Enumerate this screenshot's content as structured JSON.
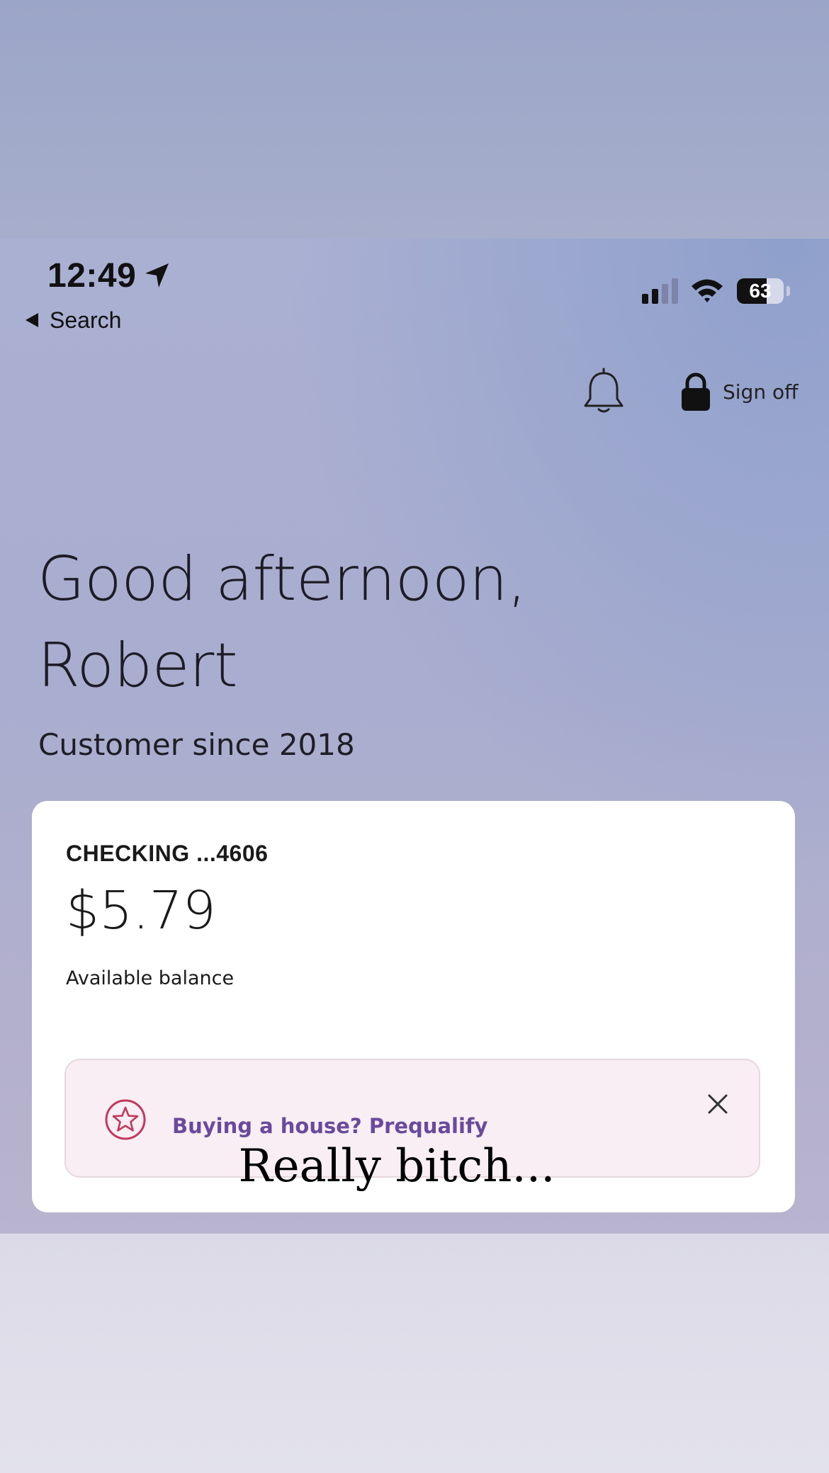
{
  "status_bar": {
    "time": "12:49",
    "battery": "63",
    "battery_level": 0.63,
    "back_label": "Search"
  },
  "header": {
    "sign_off_label": "Sign off"
  },
  "greeting": {
    "line1": "Good afternoon,",
    "line2": "Robert",
    "customer_since": "Customer since 2018"
  },
  "account": {
    "name": "CHECKING ...4606",
    "balance": "$5.79",
    "balance_label": "Available balance"
  },
  "promo": {
    "text": "Buying a house? Prequalify"
  },
  "caption": "Really bitch...",
  "colors": {
    "promo_text": "#6a4a9c",
    "promo_icon": "#c0395f",
    "promo_bg": "#f8eef3"
  },
  "icons": [
    "location-arrow-icon",
    "back-triangle-icon",
    "cellular-signal-icon",
    "wifi-icon",
    "battery-icon",
    "bell-icon",
    "lock-icon",
    "star-icon",
    "close-icon"
  ]
}
